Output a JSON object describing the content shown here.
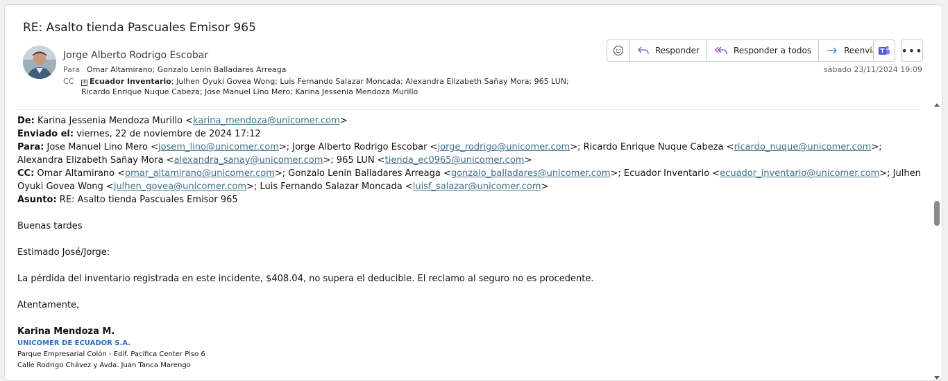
{
  "email": {
    "subject": "RE: Asalto tienda Pascuales Emisor 965",
    "sender": "Jorge Alberto Rodrigo Escobar",
    "to_label": "Para",
    "to": "Omar Altamirano; Gonzalo Lenin Balladares Arreaga",
    "cc_label": "CC",
    "cc_group": "Ecuador Inventario",
    "cc_rest_line1": "; Julhen Oyuki Govea Wong; Luis Fernando Salazar Moncada; Alexandra Elizabeth Sañay Mora; 965 LUN;",
    "cc_line2": "Ricardo Enrique Nuque Cabeza; Jose Manuel Lino Mero; Karina Jessenia Mendoza Murillo",
    "date": "sábado 23/11/2024 19:09"
  },
  "toolbar": {
    "reply": "Responder",
    "reply_all": "Responder a todos",
    "forward": "Reenviar",
    "more": "•••"
  },
  "quoted": {
    "from_label": "De:",
    "from_name": "Karina Jessenia Mendoza Murillo <",
    "from_email": "karina_mendoza@unicomer.com",
    "sent_label": "Enviado el:",
    "sent_value": "viernes, 22 de noviembre de 2024 17:12",
    "to_label": "Para:",
    "to_p1": "Jose Manuel Lino Mero <",
    "to_e1": "josem_lino@unicomer.com",
    "to_p2": ">; Jorge Alberto Rodrigo Escobar <",
    "to_e2": "jorge_rodrigo@unicomer.com",
    "to_p3": ">; Ricardo Enrique Nuque Cabeza <",
    "to_e3": "ricardo_nuque@unicomer.com",
    "to_p4": ">; Alexandra Elizabeth Sañay Mora <",
    "to_e4": "alexandra_sanay@unicomer.com",
    "to_p5": ">; 965 LUN <",
    "to_e5": "tienda_ec0965@unicomer.com",
    "to_p6": ">",
    "cc_label": "CC:",
    "cc_p1": "Omar Altamirano <",
    "cc_e1": "omar_altamirano@unicomer.com",
    "cc_p2": ">; Gonzalo Lenin Balladares Arreaga <",
    "cc_e2": "gonzalo_balladares@unicomer.com",
    "cc_p3": ">; Ecuador Inventario <",
    "cc_e3": "ecuador_inventario@unicomer.com",
    "cc_p4": ">; Julhen Oyuki Govea Wong <",
    "cc_e4": "julhen_govea@unicomer.com",
    "cc_p5": ">; Luis Fernando Salazar Moncada <",
    "cc_e5": "luisf_salazar@unicomer.com",
    "cc_p6": ">",
    "subject_label": "Asunto:",
    "subject_value": "RE: Asalto tienda Pascuales Emisor 965"
  },
  "message": {
    "greeting": "Buenas tardes",
    "salutation": "Estimado José/Jorge:",
    "text": "La pérdida del inventario registrada en este incidente, $408.04, no supera el deducible. El reclamo al seguro no es procedente.",
    "closing": "Atentamente,"
  },
  "signature": {
    "name": "Karina Mendoza M.",
    "company": "UNICOMER DE ECUADOR S.A.",
    "address1": "Parque Empresarial Colón - Edif. Pacífica Center Piso 6",
    "address2": "Calle Rodrigo Chávez y Avda. Juan Tanca Marengo"
  },
  "colors": {
    "link": "#3d6f8a",
    "company": "#2d6fbf",
    "teams": "#5059c9"
  }
}
